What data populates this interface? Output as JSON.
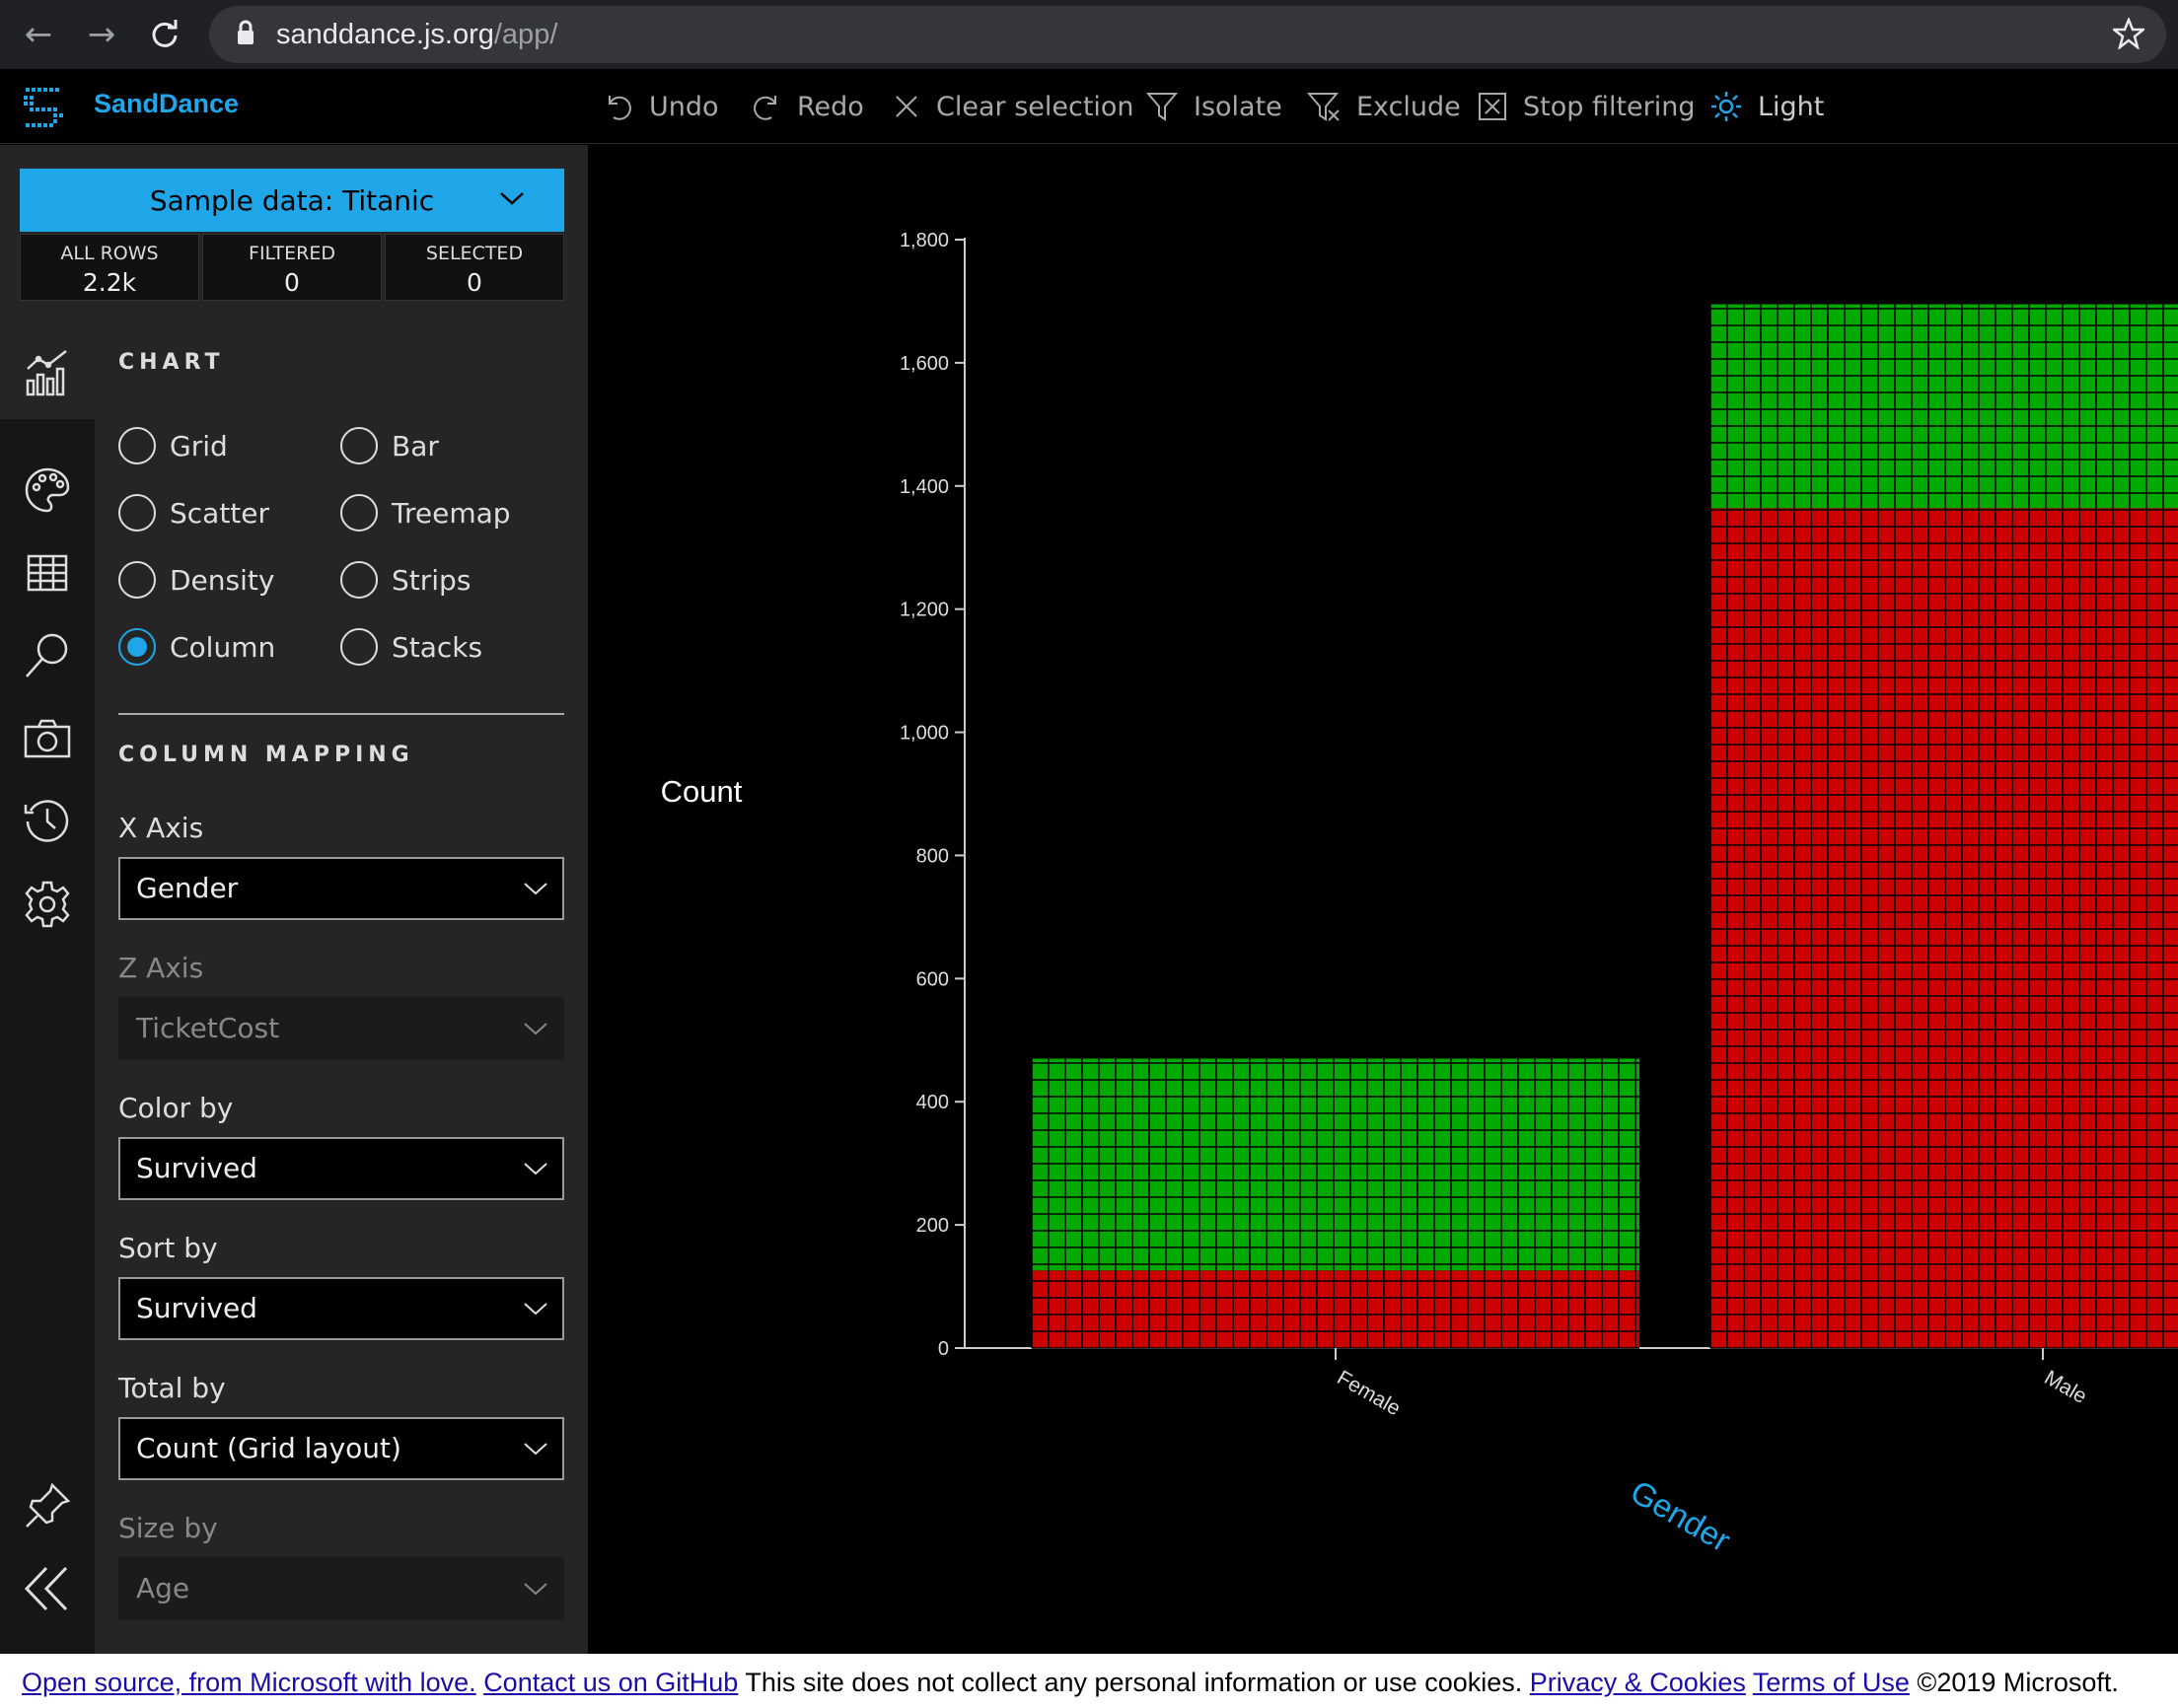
{
  "browser": {
    "url_domain": "sanddance.js.org",
    "url_path": "/app/"
  },
  "header": {
    "app_name": "SandDance",
    "toolbar": {
      "undo": "Undo",
      "redo": "Redo",
      "clear_selection": "Clear selection",
      "isolate": "Isolate",
      "exclude": "Exclude",
      "stop_filtering": "Stop filtering",
      "theme": "Light"
    }
  },
  "sidebar": {
    "dataset_button": "Sample data: Titanic",
    "stats": [
      {
        "label": "ALL ROWS",
        "value": "2.2k"
      },
      {
        "label": "FILTERED",
        "value": "0"
      },
      {
        "label": "SELECTED",
        "value": "0"
      }
    ],
    "chart_section_title": "CHART",
    "chart_types": [
      {
        "label": "Grid",
        "selected": false
      },
      {
        "label": "Bar",
        "selected": false
      },
      {
        "label": "Scatter",
        "selected": false
      },
      {
        "label": "Treemap",
        "selected": false
      },
      {
        "label": "Density",
        "selected": false
      },
      {
        "label": "Strips",
        "selected": false
      },
      {
        "label": "Column",
        "selected": true
      },
      {
        "label": "Stacks",
        "selected": false
      }
    ],
    "mapping_section_title": "COLUMN MAPPING",
    "x_axis": {
      "label": "X Axis",
      "value": "Gender"
    },
    "z_axis": {
      "label": "Z Axis",
      "value": "TicketCost"
    },
    "color_by": {
      "label": "Color by",
      "value": "Survived"
    },
    "sort_by": {
      "label": "Sort by",
      "value": "Survived"
    },
    "total_by": {
      "label": "Total by",
      "value": "Count (Grid layout)"
    },
    "size_by": {
      "label": "Size by",
      "value": "Age"
    },
    "rail_icons": [
      "chart-icon",
      "palette-icon",
      "table-icon",
      "search-icon",
      "camera-icon",
      "history-icon",
      "settings-icon",
      "pin-icon",
      "collapse-icon"
    ]
  },
  "chart_data": {
    "type": "bar",
    "title": "",
    "ylabel": "Count",
    "xlabel": "Gender",
    "categories": [
      "Female",
      "Male"
    ],
    "series": [
      {
        "color": "#cc0000",
        "values": [
          126,
          1364
        ]
      },
      {
        "color": "#00aa00",
        "values": [
          344,
          331
        ]
      }
    ],
    "ylim": [
      0,
      1800
    ],
    "yticks": [
      "0",
      "200",
      "400",
      "600",
      "800",
      "1,000",
      "1,200",
      "1,400",
      "1,600",
      "1,800"
    ],
    "colors": {
      "not_survived": "#cc0000",
      "survived": "#00aa00",
      "xlabel": "#1fa6e8"
    }
  },
  "footer": {
    "link1": "Open source, from Microsoft with love.",
    "link2": "Contact us on GitHub",
    "notice": "This site does not collect any personal information or use cookies.",
    "link3": "Privacy & Cookies",
    "link4": "Terms of Use",
    "copyright": "©2019 Microsoft."
  }
}
